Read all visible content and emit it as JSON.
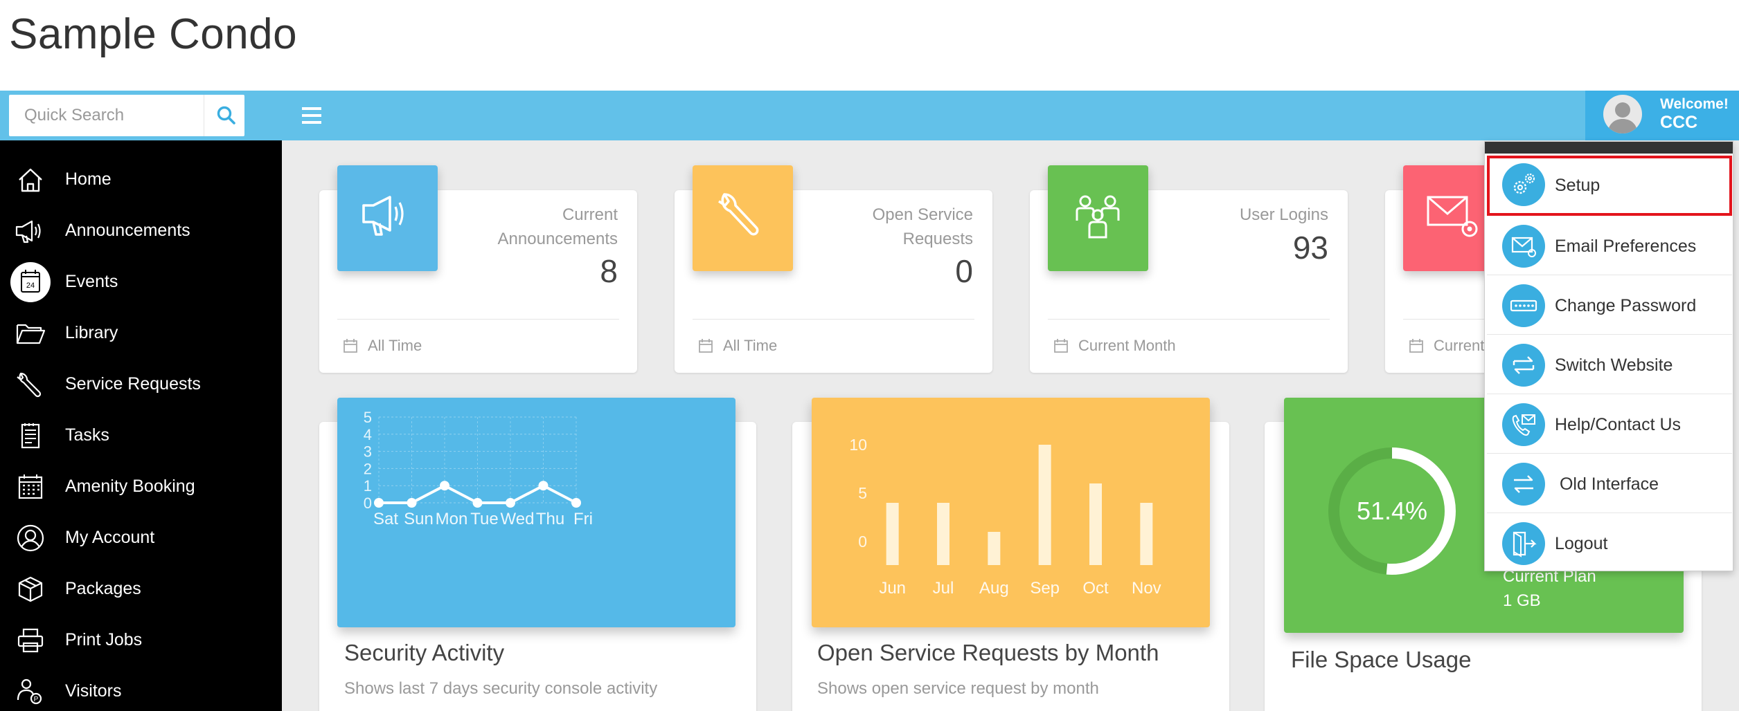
{
  "app": {
    "title": "Sample Condo"
  },
  "search": {
    "placeholder": "Quick Search"
  },
  "user": {
    "welcome": "Welcome!",
    "name": "CCC"
  },
  "sidebar": {
    "items": [
      {
        "label": "Home",
        "icon": "home-icon"
      },
      {
        "label": "Announcements",
        "icon": "megaphone-icon"
      },
      {
        "label": "Events",
        "icon": "calendar-icon"
      },
      {
        "label": "Library",
        "icon": "folder-icon"
      },
      {
        "label": "Service Requests",
        "icon": "wrench-icon"
      },
      {
        "label": "Tasks",
        "icon": "checklist-icon"
      },
      {
        "label": "Amenity Booking",
        "icon": "calendar-grid-icon"
      },
      {
        "label": "My Account",
        "icon": "user-circle-icon"
      },
      {
        "label": "Packages",
        "icon": "package-icon"
      },
      {
        "label": "Print Jobs",
        "icon": "printer-icon"
      },
      {
        "label": "Visitors",
        "icon": "visitor-icon"
      }
    ],
    "events_badge": "24"
  },
  "stats": [
    {
      "label": "Current Announcements",
      "value": "8",
      "footer": "All Time",
      "color": "#5bb9e8",
      "icon": "megaphone-icon"
    },
    {
      "label": "Open Service Requests",
      "value": "0",
      "footer": "All Time",
      "color": "#fdc35b",
      "icon": "wrench-icon"
    },
    {
      "label": "User Logins",
      "value": "93",
      "footer": "Current Month",
      "color": "#68c152",
      "icon": "users-group-icon"
    },
    {
      "label": "",
      "value": "",
      "footer": "Current",
      "color": "#fc6373",
      "icon": "email-settings-icon"
    }
  ],
  "charts": {
    "security": {
      "title": "Security Activity",
      "subtitle": "Shows last 7 days security console activity",
      "color": "#55b9e8"
    },
    "service": {
      "title": "Open Service Requests by Month",
      "subtitle": "Shows open service request by month",
      "color": "#fdc35b"
    },
    "file": {
      "title": "File Space Usage",
      "percent_label": "51.4%",
      "plan_label": "Current Plan",
      "plan_size": "1 GB",
      "color": "#68c152"
    }
  },
  "chart_data": [
    {
      "type": "line",
      "categories": [
        "Sat",
        "Sun",
        "Mon",
        "Tue",
        "Wed",
        "Thu",
        "Fri"
      ],
      "values": [
        0,
        0,
        1,
        0,
        0,
        1,
        0
      ],
      "yticks": [
        "0",
        "1",
        "2",
        "3",
        "4",
        "5"
      ],
      "ylim": [
        0,
        5
      ]
    },
    {
      "type": "bar",
      "categories": [
        "Jun",
        "Jul",
        "Aug",
        "Sep",
        "Oct",
        "Nov"
      ],
      "values": [
        4,
        4,
        1,
        10,
        6,
        4
      ],
      "yticks": [
        "0",
        "5",
        "10"
      ],
      "ylim": [
        -3,
        12
      ]
    },
    {
      "type": "pie",
      "values": [
        51.4,
        48.6
      ],
      "labels": [
        "51.4%"
      ]
    }
  ],
  "dropdown": {
    "items": [
      {
        "label": "Setup",
        "icon": "gears-icon"
      },
      {
        "label": "Email Preferences",
        "icon": "email-settings-icon"
      },
      {
        "label": "Change Password",
        "icon": "password-icon"
      },
      {
        "label": "Switch Website",
        "icon": "switch-arrows-icon"
      },
      {
        "label": "Help/Contact Us",
        "icon": "phone-mail-icon"
      },
      {
        "label": " Old Interface",
        "icon": "swap-arrows-icon"
      },
      {
        "label": "Logout",
        "icon": "logout-icon"
      }
    ]
  }
}
